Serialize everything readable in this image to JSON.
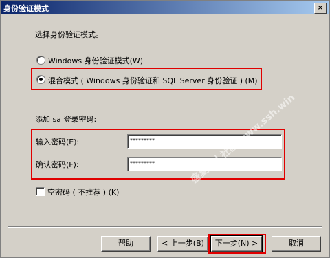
{
  "window": {
    "title": "身份验证模式",
    "close_glyph": "×"
  },
  "prompt": "选择身份验证模式。",
  "auth_modes": [
    {
      "label": "Windows 身份验证模式(W)",
      "selected": false
    },
    {
      "label": "混合模式 ( Windows 身份验证和 SQL Server 身份验证 ) (M)",
      "selected": true
    }
  ],
  "sa_section": {
    "heading": "添加 sa 登录密码:",
    "password_label": "输入密码(E):",
    "password_value": "*********",
    "confirm_label": "确认密码(F):",
    "confirm_value": "*********"
  },
  "blank_password": {
    "label": "空密码 ( 不推荐 ) (K)",
    "checked": false
  },
  "buttons": {
    "help": "帮助",
    "back": "< 上一步(B)",
    "next": "下一步(N) >",
    "cancel": "取消"
  },
  "watermark": "盛夏个人社区 www.ssh.win"
}
